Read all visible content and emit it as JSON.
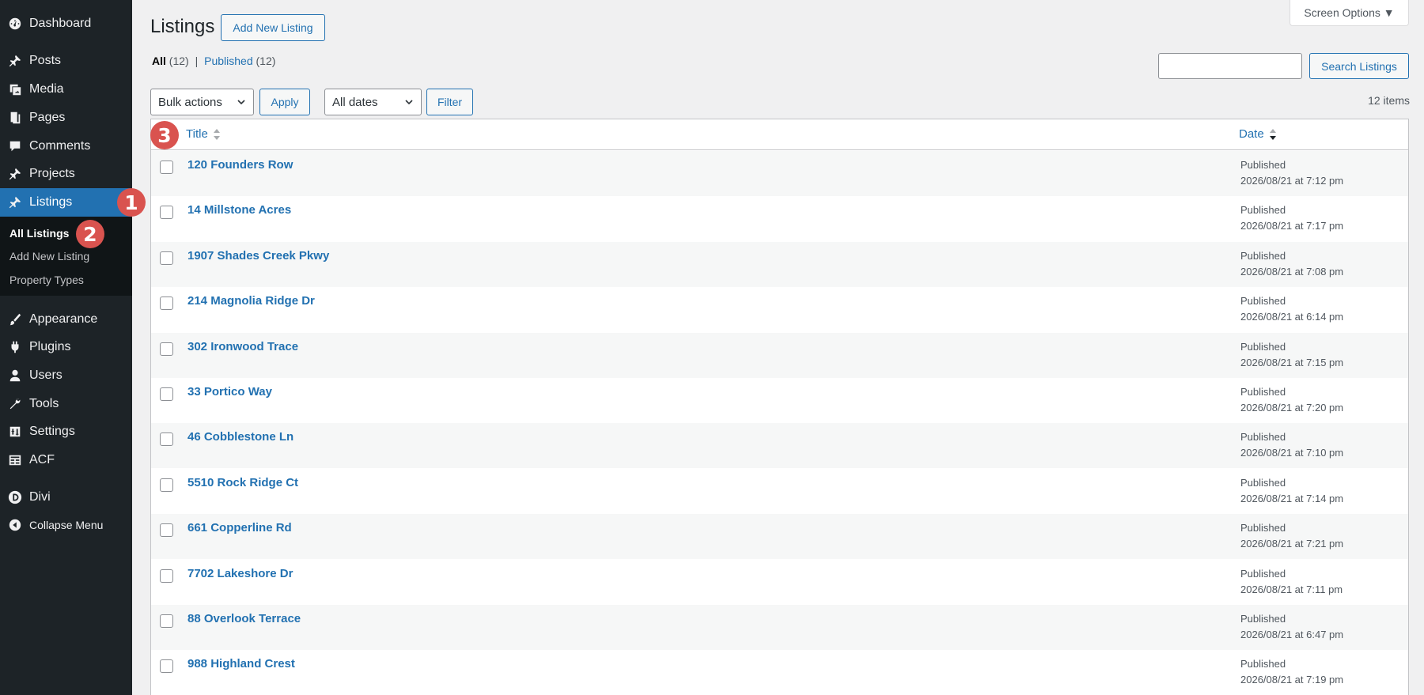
{
  "sidebar": {
    "items": [
      {
        "label": "Dashboard",
        "icon": "dashboard-icon"
      },
      {
        "label": "Posts",
        "icon": "pin-icon"
      },
      {
        "label": "Media",
        "icon": "media-icon"
      },
      {
        "label": "Pages",
        "icon": "pages-icon"
      },
      {
        "label": "Comments",
        "icon": "comment-icon"
      },
      {
        "label": "Projects",
        "icon": "pin-icon"
      },
      {
        "label": "Listings",
        "icon": "pin-icon"
      },
      {
        "label": "Appearance",
        "icon": "brush-icon"
      },
      {
        "label": "Plugins",
        "icon": "plugin-icon"
      },
      {
        "label": "Users",
        "icon": "user-icon"
      },
      {
        "label": "Tools",
        "icon": "wrench-icon"
      },
      {
        "label": "Settings",
        "icon": "settings-icon"
      },
      {
        "label": "ACF",
        "icon": "acf-icon"
      },
      {
        "label": "Divi",
        "icon": "divi-icon"
      },
      {
        "label": "Collapse Menu",
        "icon": "collapse-icon"
      }
    ],
    "submenu": [
      "All Listings",
      "Add New Listing",
      "Property Types"
    ]
  },
  "badges": [
    "1",
    "2",
    "3"
  ],
  "header": {
    "title": "Listings",
    "add_new": "Add New Listing",
    "screen_options": "Screen Options ▼"
  },
  "views": {
    "all_label": "All",
    "all_count": "(12)",
    "separator": "|",
    "published_label": "Published",
    "published_count": "(12)"
  },
  "search": {
    "button": "Search Listings",
    "value": ""
  },
  "filters": {
    "bulk_actions": "Bulk actions",
    "apply": "Apply",
    "dates": "All dates",
    "filter": "Filter",
    "items_count": "12 items"
  },
  "table": {
    "columns": {
      "title": "Title",
      "date": "Date"
    },
    "rows": [
      {
        "title": "120 Founders Row",
        "status": "Published",
        "date": "2026/08/21 at 7:12 pm"
      },
      {
        "title": "14 Millstone Acres",
        "status": "Published",
        "date": "2026/08/21 at 7:17 pm"
      },
      {
        "title": "1907 Shades Creek Pkwy",
        "status": "Published",
        "date": "2026/08/21 at 7:08 pm"
      },
      {
        "title": "214 Magnolia Ridge Dr",
        "status": "Published",
        "date": "2026/08/21 at 6:14 pm"
      },
      {
        "title": "302 Ironwood Trace",
        "status": "Published",
        "date": "2026/08/21 at 7:15 pm"
      },
      {
        "title": "33 Portico Way",
        "status": "Published",
        "date": "2026/08/21 at 7:20 pm"
      },
      {
        "title": "46 Cobblestone Ln",
        "status": "Published",
        "date": "2026/08/21 at 7:10 pm"
      },
      {
        "title": "5510 Rock Ridge Ct",
        "status": "Published",
        "date": "2026/08/21 at 7:14 pm"
      },
      {
        "title": "661 Copperline Rd",
        "status": "Published",
        "date": "2026/08/21 at 7:21 pm"
      },
      {
        "title": "7702 Lakeshore Dr",
        "status": "Published",
        "date": "2026/08/21 at 7:11 pm"
      },
      {
        "title": "88 Overlook Terrace",
        "status": "Published",
        "date": "2026/08/21 at 6:47 pm"
      },
      {
        "title": "988 Highland Crest",
        "status": "Published",
        "date": "2026/08/21 at 7:19 pm"
      }
    ]
  },
  "colors": {
    "sidebar_bg": "#1d2327",
    "active_bg": "#2271b1",
    "link": "#2271b1",
    "badge": "#d9534f"
  }
}
